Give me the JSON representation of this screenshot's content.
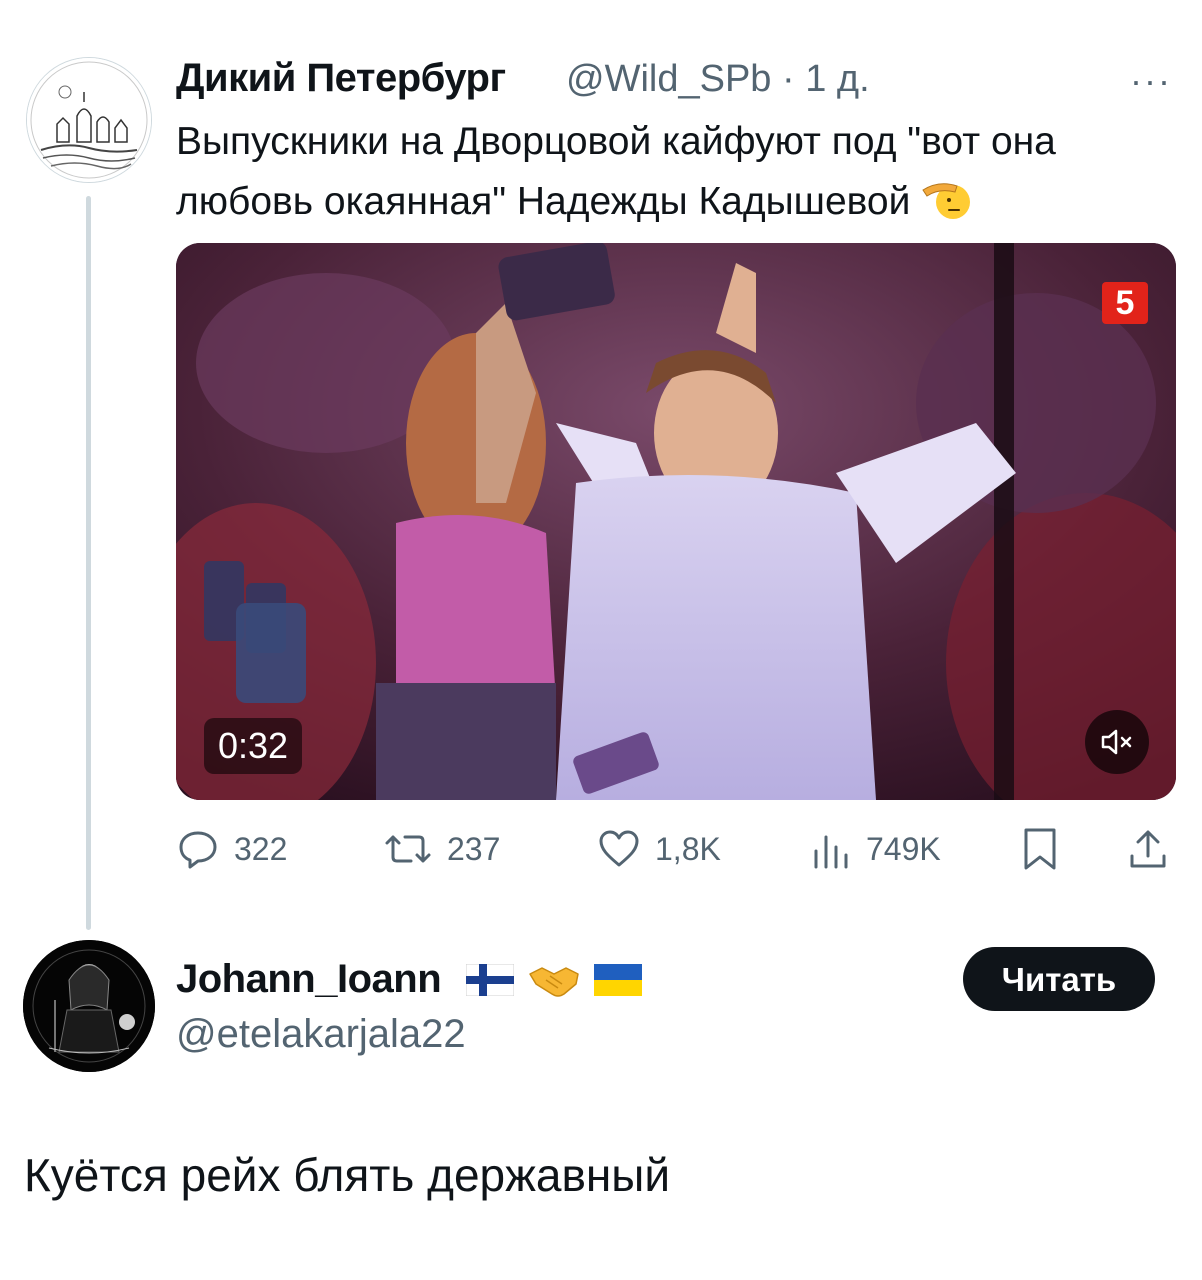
{
  "original_tweet": {
    "author_name": "Дикий Петербург",
    "author_handle": "@Wild_SPb",
    "separator": "·",
    "time_ago": "1 д.",
    "more_label": "···",
    "text": "Выпускники на Дворцовой кайфуют под \"вот она любовь окаянная\" Надежды Кадышевой",
    "trailing_emoji": "saluting-face-emoji",
    "media": {
      "type": "video",
      "duration": "0:32",
      "channel_logo": "5",
      "muted": true
    },
    "stats": {
      "replies": "322",
      "reposts": "237",
      "likes": "1,8K",
      "views": "749K"
    }
  },
  "reply": {
    "author_name": "Johann_Ioann",
    "name_emojis": [
      "finland-flag-emoji",
      "handshake-emoji",
      "ukraine-flag-emoji"
    ],
    "author_handle": "@etelakarjala22",
    "follow_label": "Читать",
    "text": "Куётся рейх блять державный"
  },
  "colors": {
    "text_primary": "#0f1419",
    "text_secondary": "#536471",
    "thread_line": "#cfd9de",
    "button_bg": "#0f1419",
    "button_text": "#ffffff"
  }
}
